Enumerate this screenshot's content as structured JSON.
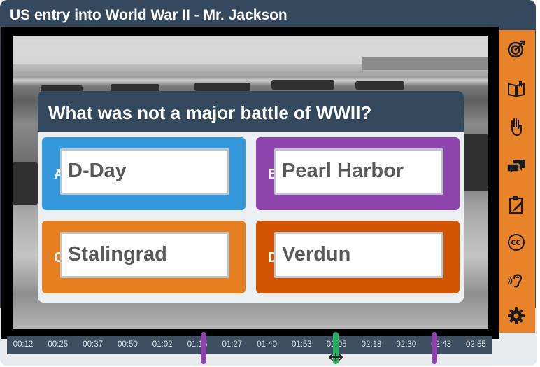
{
  "title": "US entry into World War II - Mr. Jackson",
  "question": {
    "text": "What was not a major battle of WWII?",
    "answers": [
      {
        "letter": "A",
        "text": "D-Day",
        "color": "#3498db"
      },
      {
        "letter": "B",
        "text": "Pearl Harbor",
        "color": "#8e44ad"
      },
      {
        "letter": "C",
        "text": "Stalingrad",
        "color": "#e67e22"
      },
      {
        "letter": "D",
        "text": "Verdun",
        "color": "#d35400"
      }
    ]
  },
  "sidebar": {
    "color": "#e8832a",
    "items": [
      {
        "name": "target-icon"
      },
      {
        "name": "book-icon"
      },
      {
        "name": "raised-hand-icon"
      },
      {
        "name": "chat-bubbles-icon"
      },
      {
        "name": "notepad-icon"
      },
      {
        "name": "closed-captions-icon"
      },
      {
        "name": "hearing-icon"
      },
      {
        "name": "gear-icon"
      }
    ]
  },
  "timeline": {
    "ticks": [
      "00:12",
      "00:25",
      "00:37",
      "00:50",
      "01:02",
      "01:15",
      "01:27",
      "01:40",
      "01:53",
      "02:05",
      "02:18",
      "02:30",
      "02:43",
      "02:55"
    ],
    "markers": [
      {
        "name": "question-marker-1",
        "color": "#8e44ad"
      },
      {
        "name": "playhead-marker",
        "color": "#27ae60"
      },
      {
        "name": "question-marker-2",
        "color": "#8e44ad"
      }
    ]
  },
  "colors": {
    "header": "#34495e",
    "accent": "#e8832a"
  }
}
